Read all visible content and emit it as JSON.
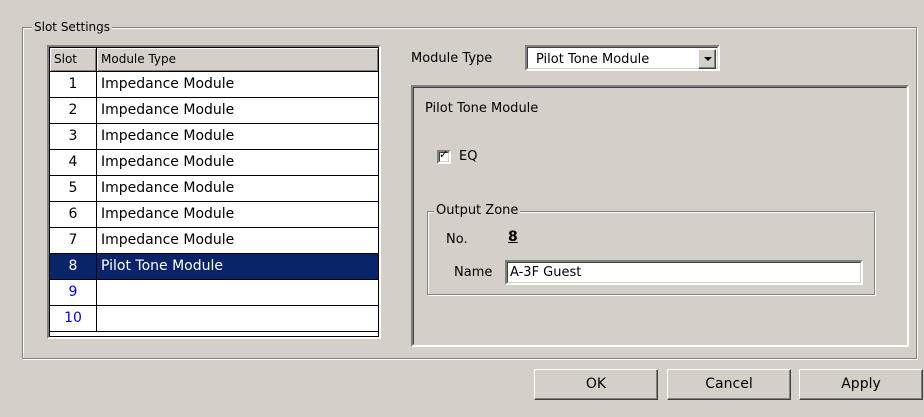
{
  "group": {
    "title": "Slot Settings"
  },
  "table": {
    "headers": {
      "slot": "Slot",
      "type": "Module Type"
    },
    "rows": [
      {
        "slot": "1",
        "type": "Impedance Module"
      },
      {
        "slot": "2",
        "type": "Impedance Module"
      },
      {
        "slot": "3",
        "type": "Impedance Module"
      },
      {
        "slot": "4",
        "type": "Impedance Module"
      },
      {
        "slot": "5",
        "type": "Impedance Module"
      },
      {
        "slot": "6",
        "type": "Impedance Module"
      },
      {
        "slot": "7",
        "type": "Impedance Module"
      },
      {
        "slot": "8",
        "type": "Pilot Tone Module"
      },
      {
        "slot": "9",
        "type": ""
      },
      {
        "slot": "10",
        "type": ""
      }
    ],
    "selected_index": 7
  },
  "module_type": {
    "label": "Module Type",
    "selected": "Pilot Tone Module"
  },
  "panel": {
    "title": "Pilot Tone Module",
    "eq": {
      "label": "EQ",
      "checked": true,
      "mark": "✓"
    },
    "output_zone": {
      "title": "Output Zone",
      "no_label": "No.",
      "no_value": "8",
      "name_label": "Name",
      "name_value": "A-3F Guest"
    }
  },
  "buttons": {
    "ok": "OK",
    "cancel": "Cancel",
    "apply": "Apply"
  },
  "colors": {
    "selection": "#0a246a",
    "empty_slot_text": "#0000ff",
    "face": "#d4d0c8"
  }
}
